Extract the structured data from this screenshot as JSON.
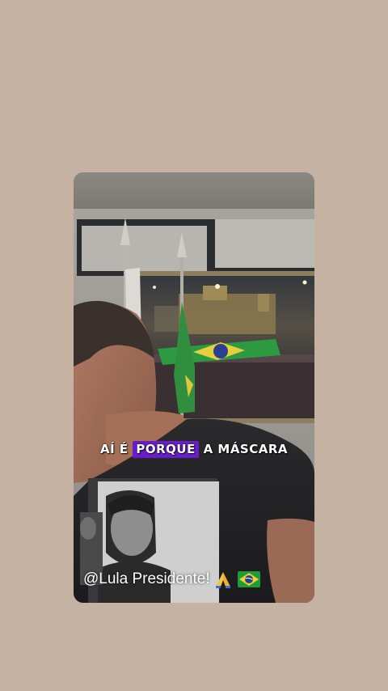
{
  "story": {
    "subtitle": {
      "before": "AÍ É ",
      "highlight": "PORQUE",
      "after": " A MÁSCARA"
    },
    "caption": "@Lula Presidente!",
    "caption_emojis": [
      "folded-hands-icon",
      "brazil-flag-icon"
    ],
    "colors": {
      "background": "#c6b2a2",
      "highlight": "#6a1ec9",
      "text": "#ffffff"
    }
  }
}
